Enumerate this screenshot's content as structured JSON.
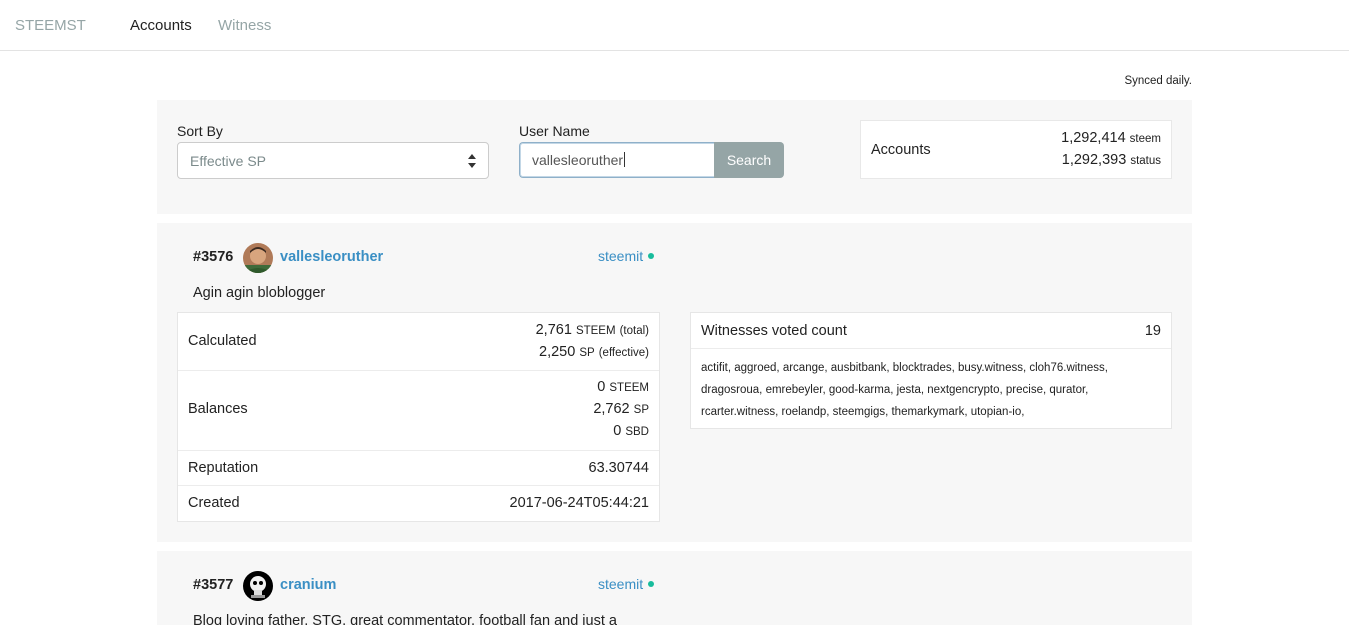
{
  "nav": {
    "brand": "STEEMST",
    "links": [
      {
        "label": "Accounts",
        "active": true
      },
      {
        "label": "Witness",
        "active": false
      }
    ]
  },
  "synced_note": "Synced daily.",
  "filter": {
    "sort_label": "Sort By",
    "sort_value": "Effective SP",
    "user_label": "User Name",
    "user_value": "vallesleoruther",
    "search_button": "Search"
  },
  "stats": {
    "title": "Accounts",
    "steem_count": "1,292,414",
    "steem_unit": "steem",
    "status_count": "1,292,393",
    "status_unit": "status"
  },
  "accounts": [
    {
      "rank": "#3576",
      "username": "vallesleoruther",
      "platform": "steemit",
      "bio": "Agin agin bloblogger",
      "calculated_label": "Calculated",
      "calculated_steem": "2,761",
      "calculated_steem_unit": "STEEM",
      "calculated_steem_note": "(total)",
      "calculated_sp": "2,250",
      "calculated_sp_unit": "SP",
      "calculated_sp_note": "(effective)",
      "balances_label": "Balances",
      "balance_steem": "0",
      "balance_steem_unit": "STEEM",
      "balance_sp": "2,762",
      "balance_sp_unit": "SP",
      "balance_sbd": "0",
      "balance_sbd_unit": "SBD",
      "reputation_label": "Reputation",
      "reputation": "63.30744",
      "created_label": "Created",
      "created": "2017-06-24T05:44:21",
      "witness_title": "Witnesses voted count",
      "witness_count": "19",
      "witness_list": "actifit, aggroed, arcange, ausbitbank, blocktrades, busy.witness, cloh76.witness, dragosroua, emrebeyler, good-karma, jesta, nextgencrypto, precise, qurator, rcarter.witness, roelandp, steemgigs, themarkymark, utopian-io,"
    },
    {
      "rank": "#3577",
      "username": "cranium",
      "platform": "steemit",
      "bio": "Blog loving father, STG, great commentator, football fan and just a"
    }
  ],
  "colors": {
    "accent_link": "#3a8fc4",
    "status_online": "#18bc9c",
    "muted": "#95a5a6",
    "panel_bg": "#f7f7f7"
  }
}
